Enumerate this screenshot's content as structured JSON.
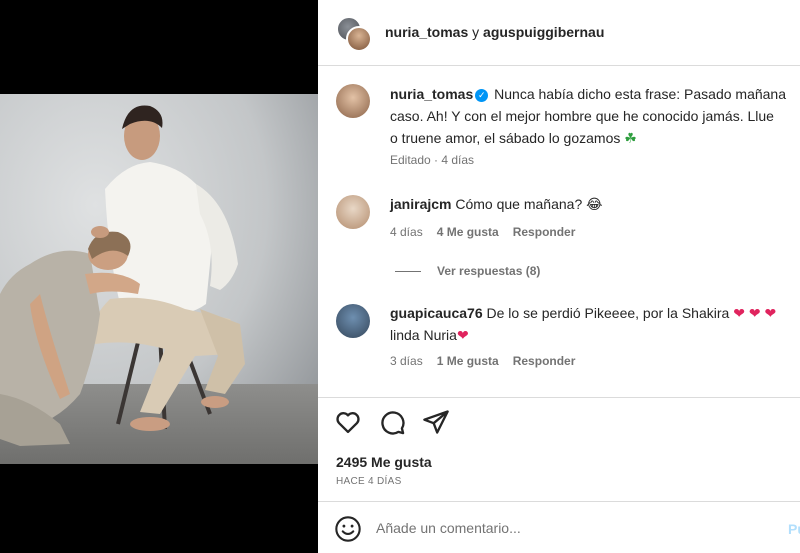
{
  "post": {
    "header": {
      "author": "nuria_tomas",
      "connector": " y ",
      "coauthor": "aguspuiggibernau"
    },
    "caption": {
      "username": "nuria_tomas",
      "verified_icon": "verified-badge-icon",
      "line1": "Nunca había dicho esta frase: Pasado mañana",
      "line2": "caso. Ah! Y con el mejor hombre que he conocido jamás. Llue",
      "line3": "o truene amor, el sábado lo gozamos",
      "line3_emoji": "☘",
      "meta": "Editado · 4 días"
    },
    "comments": [
      {
        "username": "janirajcm",
        "text": "Cómo que mañana?",
        "emoji": "😂",
        "time": "4 días",
        "likes": "4 Me gusta",
        "reply": "Responder"
      },
      {
        "username": "guapicauca76",
        "text": "De lo se perdió Pikeeee, por la Shakira",
        "hearts": "❤ ❤ ❤",
        "line2": "linda Nuria",
        "line2_heart": "❤",
        "time": "3 días",
        "likes": "1 Me gusta",
        "reply": "Responder"
      }
    ],
    "view_replies": "Ver respuestas (8)",
    "actions": {
      "icons": [
        "heart-icon",
        "comment-icon",
        "share-icon"
      ]
    },
    "likes": "2495 Me gusta",
    "time_ago": "HACE 4 DÍAS",
    "composer": {
      "emoji_icon": "smiley-icon",
      "placeholder": "Añade un comentario...",
      "publish": "Pu"
    }
  },
  "colors": {
    "accent": "#0095f6",
    "heart": "#e0245e",
    "muted": "#737373",
    "border": "#dbdbdb"
  }
}
